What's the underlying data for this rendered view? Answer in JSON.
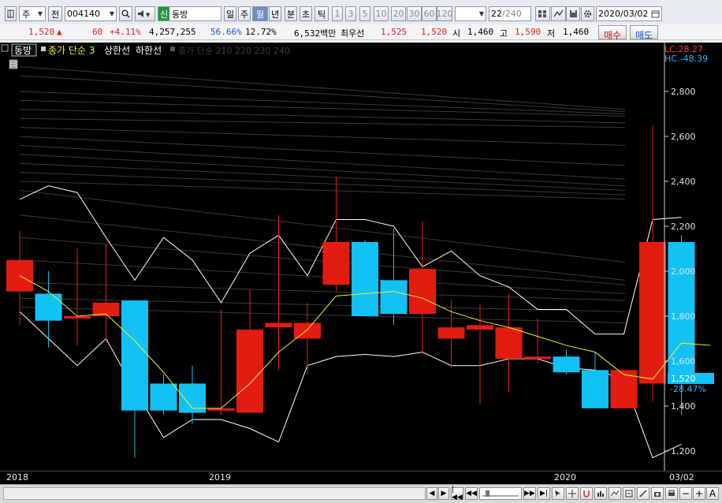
{
  "toolbar": {
    "period_select": "주",
    "prev_label": "전",
    "stock_code": "004140",
    "stock_badge": "신",
    "stock_name": "동방",
    "period_tabs": [
      "일",
      "주",
      "월",
      "년",
      "분",
      "초",
      "틱"
    ],
    "active_period": "월",
    "interval_numbers": [
      "1",
      "3",
      "5",
      "10",
      "20",
      "30",
      "60",
      "120"
    ],
    "count_value": "22",
    "count_total": "/240",
    "date": "2020/03/02",
    "accent_color": "#6f8fbf"
  },
  "quote": {
    "price": "1,520",
    "direction": "▲",
    "change": "60",
    "change_pct": "+4.11%",
    "volume": "4,257,255",
    "turnover_pct": "56.66%",
    "ratio_pct": "12.72%",
    "amount": "6,532백만",
    "best_ask_label": "최우선",
    "best_ask": "1,525",
    "best_bid": "1,520",
    "open_label": "시",
    "open": "1,460",
    "high_label": "고",
    "high": "1,590",
    "low_label": "저",
    "low": "1,460",
    "buy_label": "매수",
    "sell_label": "매도"
  },
  "chart_header": {
    "tab_label": "동방",
    "ma_legend": "종가 단순 3",
    "upper_band": "상한선",
    "lower_band": "하한선",
    "faded_legend": "종가 단순 210 220 230 240",
    "lc": "LC:28.27",
    "hc": "HC:-48.39"
  },
  "colors": {
    "up": "#e31c12",
    "down": "#12c1f5",
    "ma": "#f0ef2a",
    "band": "#ffffff",
    "lc": "#ff3b3b",
    "hc": "#35b0ff"
  },
  "price_badge": {
    "price": "1,520",
    "pct": "-28.47%"
  },
  "chart_data": {
    "type": "candlestick",
    "title": "",
    "x": [
      "2018-01",
      "2018-02",
      "2018-03",
      "2018-04",
      "2018-05",
      "2018-06",
      "2018-07",
      "2018-08",
      "2018-09",
      "2018-10",
      "2018-11",
      "2018-12",
      "2019-01",
      "2019-02",
      "2019-03",
      "2019-04",
      "2019-05",
      "2019-06",
      "2019-07",
      "2019-08",
      "2019-09",
      "2019-10",
      "2019-11",
      "2019-12",
      "2020-01",
      "2020-02",
      "2020-03"
    ],
    "open": [
      1910,
      1900,
      1800,
      1800,
      1870,
      1500,
      1500,
      1380,
      1370,
      1750,
      1700,
      1940,
      2130,
      1960,
      1810,
      1700,
      1740,
      1610,
      1620,
      1620,
      1560,
      1390,
      1500,
      2130
    ],
    "close": [
      2050,
      1780,
      1800,
      1860,
      1380,
      1380,
      1370,
      1390,
      1740,
      1770,
      1770,
      2130,
      1800,
      1810,
      2010,
      1750,
      1760,
      1750,
      1620,
      1550,
      1390,
      1560,
      2130,
      1520
    ],
    "high": [
      2180,
      2000,
      2100,
      2120,
      1870,
      1540,
      1580,
      1830,
      1920,
      2250,
      1860,
      2420,
      2140,
      2190,
      2220,
      1870,
      1850,
      1900,
      1790,
      1650,
      1640,
      1560,
      2650,
      2160
    ],
    "low": [
      1760,
      1660,
      1670,
      1680,
      1170,
      1360,
      1320,
      1360,
      1370,
      1560,
      1540,
      1910,
      1800,
      1760,
      1630,
      1570,
      1410,
      1460,
      1590,
      1540,
      1420,
      1390,
      1420,
      1360
    ],
    "ma3": [
      1980,
      1910,
      1800,
      1810,
      1690,
      1550,
      1390,
      1390,
      1500,
      1640,
      1740,
      1890,
      1900,
      1910,
      1880,
      1820,
      1780,
      1750,
      1710,
      1670,
      1640,
      1540,
      1520,
      1680,
      1670
    ],
    "upper_band": [
      2320,
      2380,
      2350,
      2150,
      1960,
      2150,
      2050,
      1860,
      2080,
      2160,
      1980,
      2230,
      2230,
      2200,
      2020,
      2090,
      1980,
      1930,
      1830,
      1830,
      1720,
      1720,
      2230,
      2240
    ],
    "lower_band": [
      1820,
      1700,
      1580,
      1700,
      1470,
      1260,
      1340,
      1340,
      1300,
      1240,
      1580,
      1620,
      1630,
      1620,
      1640,
      1580,
      1580,
      1610,
      1610,
      1570,
      1560,
      1520,
      1170,
      1230
    ],
    "y_ticks": [
      "2,800",
      "2,600",
      "2,400",
      "2,200",
      "2,000",
      "1,800",
      "1,600",
      "1,400",
      "1,200"
    ],
    "ylim": [
      1140,
      2900
    ],
    "x_tick_labels": [
      "2018",
      "2019",
      "2020",
      "03/02"
    ]
  },
  "bottom": {
    "controls": [
      "◀",
      "▶",
      "|◀◀",
      "◀◀",
      "▶▶",
      "▶|",
      "−",
      "+",
      "A"
    ]
  }
}
